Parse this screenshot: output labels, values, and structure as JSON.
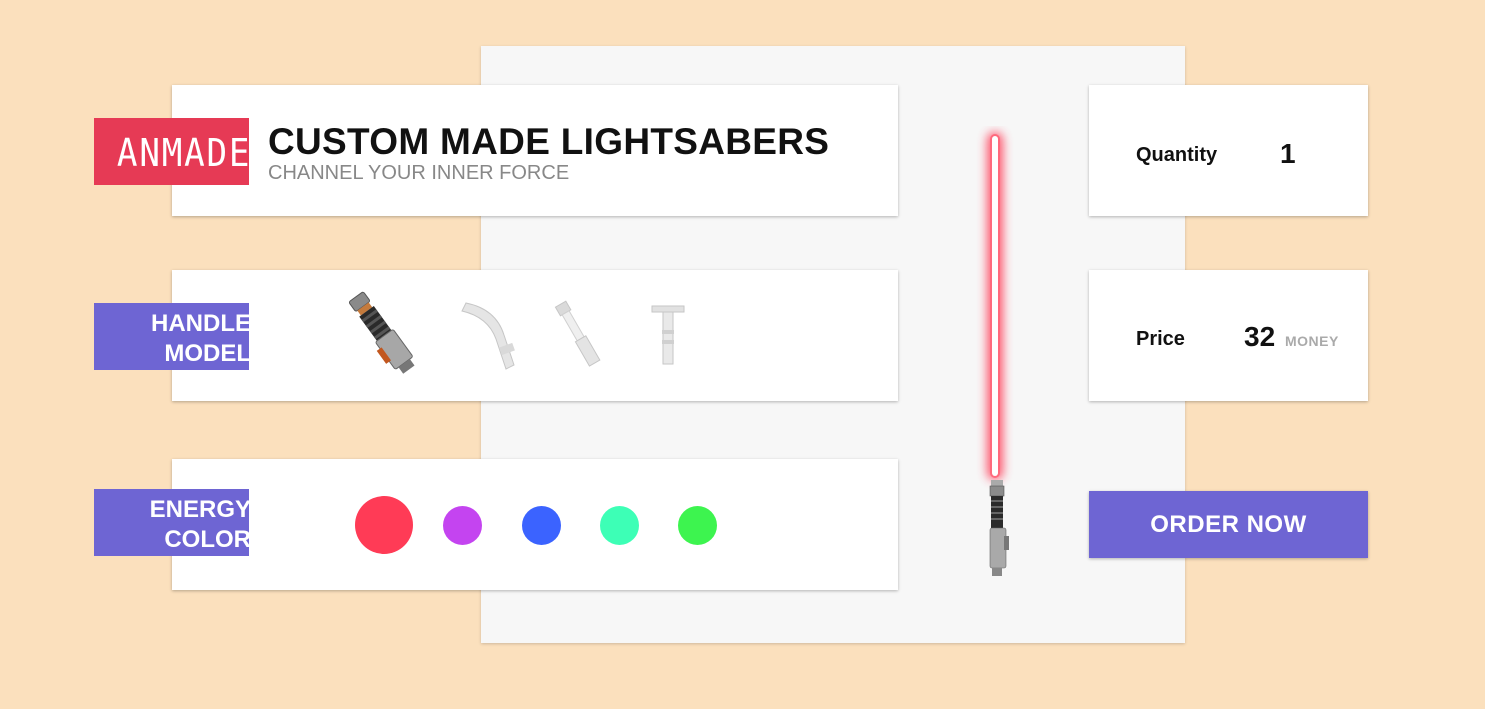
{
  "brand": {
    "tag_text": "ANMADE"
  },
  "header": {
    "title": "CUSTOM MADE LIGHTSABERS",
    "subtitle": "CHANNEL YOUR INNER FORCE"
  },
  "handle_section": {
    "label": "HANDLE\nMODEL",
    "options": [
      "handle-model-1",
      "handle-model-2",
      "handle-model-3",
      "handle-model-4"
    ],
    "selected_index": 0
  },
  "energy_section": {
    "label": "ENERGY\nCOLOR",
    "colors": [
      "#ff3b56",
      "#c444f0",
      "#3b63ff",
      "#3dffb6",
      "#3df44f"
    ],
    "selected_index": 0
  },
  "quantity": {
    "label": "Quantity",
    "value": "1"
  },
  "price": {
    "label": "Price",
    "value": "32",
    "unit": "MONEY"
  },
  "order_button": {
    "label": "ORDER NOW"
  },
  "preview": {
    "blade_color": "#ff3b56"
  }
}
